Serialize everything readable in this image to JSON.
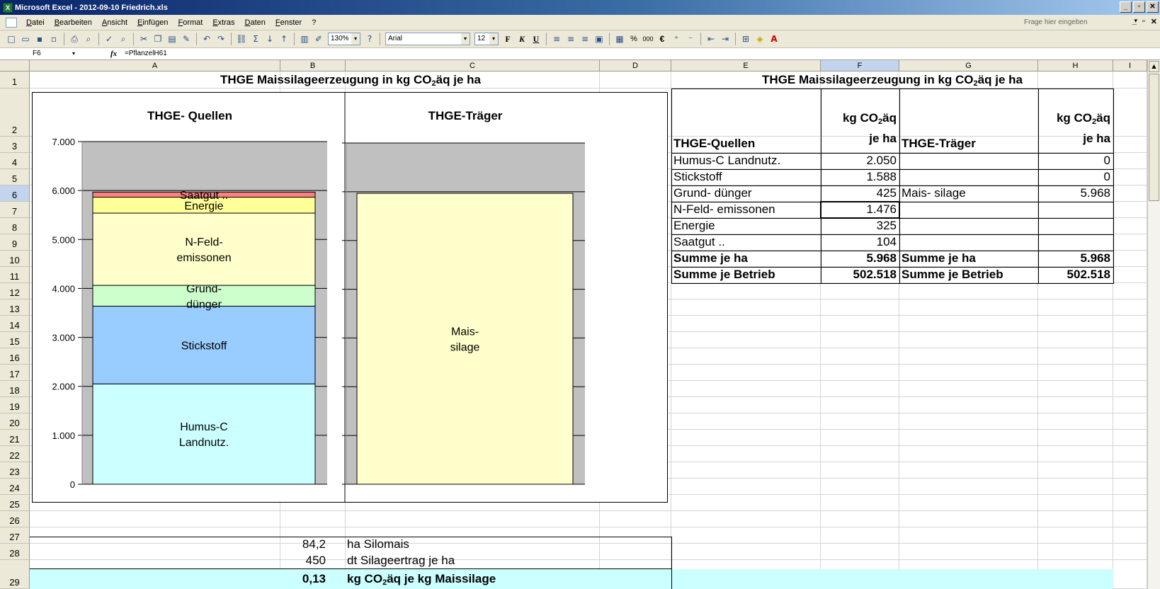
{
  "window": {
    "title": "Microsoft Excel - 2012-09-10 Friedrich.xls",
    "app_icon": "excel-icon"
  },
  "menu": {
    "items": [
      "Datei",
      "Bearbeiten",
      "Ansicht",
      "Einfügen",
      "Format",
      "Extras",
      "Daten",
      "Fenster",
      "?"
    ],
    "help_placeholder": "Frage hier eingeben"
  },
  "toolbar": {
    "zoom": "130%",
    "font": "Arial",
    "font_size": "12",
    "bold": "F",
    "italic": "K",
    "underline": "U",
    "percent": "%",
    "thousands": "000",
    "euro": "€"
  },
  "formula_bar": {
    "name_box": "F6",
    "fx": "fx",
    "formula": "=PflanzelH61"
  },
  "columns": [
    "A",
    "B",
    "C",
    "D",
    "E",
    "F",
    "G",
    "H",
    "I"
  ],
  "selected_column": "F",
  "rows": [
    "1",
    "2",
    "3",
    "4",
    "5",
    "6",
    "7",
    "8",
    "9",
    "10",
    "11",
    "12",
    "13",
    "14",
    "15",
    "16",
    "17",
    "18",
    "19",
    "20",
    "21",
    "22",
    "23",
    "24",
    "25",
    "26",
    "27",
    "28",
    "29"
  ],
  "selected_row": "6",
  "sheet": {
    "title_left_pre": "THGE Maissilageerzeugung in kg CO",
    "title_left_sub": "2",
    "title_left_post": "äq je ha",
    "title_right_pre": "THGE Maissilageerzeugung in kg CO",
    "title_right_sub": "2",
    "title_right_post": "äq je ha",
    "table": {
      "hdr_unit_a_pre": "kg CO",
      "hdr_unit_a_sub": "2",
      "hdr_unit_a_post": "äq",
      "hdr_unit_a_line2": "je ha",
      "hdr_unit_b_pre": "kg CO",
      "hdr_unit_b_sub": "2",
      "hdr_unit_b_post": "äq",
      "hdr_unit_b_line2": "je ha",
      "hdr_sources": "THGE-Quellen",
      "hdr_carriers": "THGE-Träger",
      "rows": [
        {
          "source": "Humus-C Landnutz.",
          "value": "2.050",
          "carrier": "",
          "carrier_value": "0"
        },
        {
          "source": "Stickstoff",
          "value": "1.588",
          "carrier": "",
          "carrier_value": "0"
        },
        {
          "source": "Grund- dünger",
          "value": "425",
          "carrier": "Mais- silage",
          "carrier_value": "5.968"
        },
        {
          "source": "N-Feld- emissonen",
          "value": "1.476",
          "carrier": "",
          "carrier_value": ""
        },
        {
          "source": "Energie",
          "value": "325",
          "carrier": "",
          "carrier_value": ""
        },
        {
          "source": "Saatgut ..",
          "value": "104",
          "carrier": "",
          "carrier_value": ""
        }
      ],
      "sum_ha_label": "Summe je ha",
      "sum_ha_value": "5.968",
      "sum_ha_label_b": "Summe je ha",
      "sum_ha_value_b": "5.968",
      "sum_farm_label": "Summe je Betrieb",
      "sum_farm_value": "502.518",
      "sum_farm_label_b": "Summe je Betrieb",
      "sum_farm_value_b": "502.518"
    },
    "bottom": {
      "area_value": "84,2",
      "area_label": "ha Silomais",
      "yield_value": "450",
      "yield_label": "dt Silageertrag je ha",
      "intensity_value": "0,13",
      "intensity_label_pre": "kg CO",
      "intensity_label_sub": "2",
      "intensity_label_post": "äq je kg Maissilage"
    }
  },
  "chart_data": [
    {
      "type": "bar",
      "stacked": true,
      "title": "THGE- Quellen",
      "ylim": [
        0,
        7000
      ],
      "yticks": [
        "0",
        "1.000",
        "2.000",
        "3.000",
        "4.000",
        "5.000",
        "6.000",
        "7.000"
      ],
      "grid": true,
      "series": [
        {
          "name": "Humus-C Landnutz.",
          "label_lines": [
            "Humus-C",
            "Landnutz."
          ],
          "value": 2050,
          "color": "#ccffff"
        },
        {
          "name": "Stickstoff",
          "label_lines": [
            "Stickstoff"
          ],
          "value": 1588,
          "color": "#99ccff"
        },
        {
          "name": "Grund- dünger",
          "label_lines": [
            "Grund-",
            "dünger"
          ],
          "value": 425,
          "color": "#ccffcc"
        },
        {
          "name": "N-Feld- emissonen",
          "label_lines": [
            "N-Feld-",
            "emissonen"
          ],
          "value": 1476,
          "color": "#ffffcc"
        },
        {
          "name": "Energie",
          "label_lines": [
            "Energie"
          ],
          "value": 325,
          "color": "#ffff99"
        },
        {
          "name": "Saatgut ..",
          "label_lines": [
            "Saatgut .."
          ],
          "value": 104,
          "color": "#ff8080"
        }
      ]
    },
    {
      "type": "bar",
      "stacked": true,
      "title": "THGE-Träger",
      "ylim": [
        0,
        7000
      ],
      "grid": true,
      "series": [
        {
          "name": "Mais- silage",
          "label_lines": [
            "Mais-",
            "silage"
          ],
          "value": 5968,
          "color": "#ffffcc"
        }
      ]
    }
  ]
}
